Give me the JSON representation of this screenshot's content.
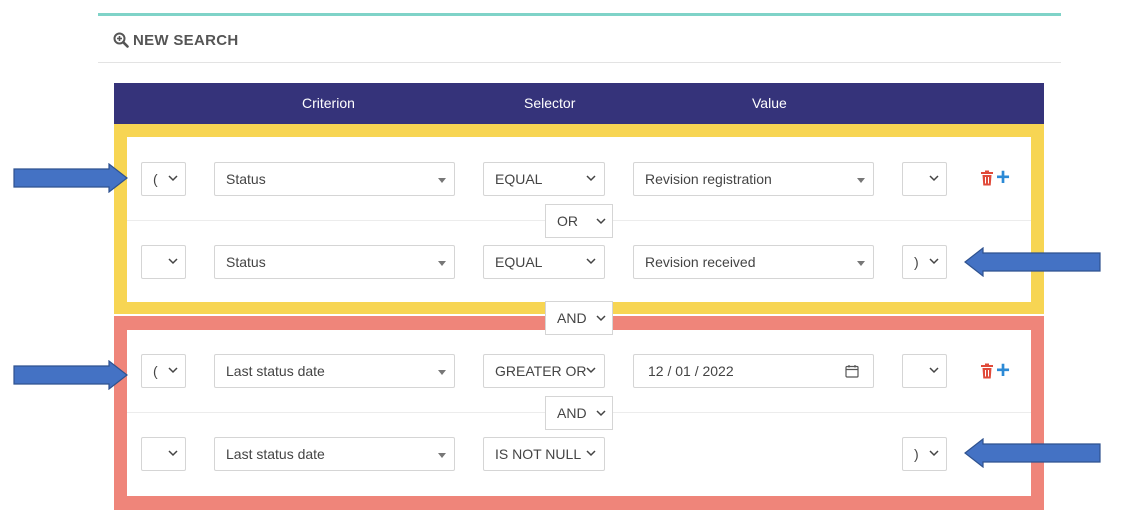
{
  "header": {
    "title": "NEW SEARCH",
    "icon": "zoom-in-icon"
  },
  "columns": {
    "criterion": "Criterion",
    "selector": "Selector",
    "value": "Value"
  },
  "logic_between_groups": "AND",
  "groups": [
    {
      "color": "#f7d553",
      "logic": "OR",
      "rows": [
        {
          "open_paren": "(",
          "criterion": "Status",
          "selector": "EQUAL",
          "value": "Revision registration",
          "close_paren": ""
        },
        {
          "open_paren": "",
          "criterion": "Status",
          "selector": "EQUAL",
          "value": "Revision received",
          "close_paren": ")"
        }
      ]
    },
    {
      "color": "#ef857a",
      "logic": "AND",
      "rows": [
        {
          "open_paren": "(",
          "criterion": "Last status date",
          "selector": "GREATER OR EQUAL",
          "value": "12 / 01 / 2022",
          "close_paren": ""
        },
        {
          "open_paren": "",
          "criterion": "Last status date",
          "selector": "IS NOT NULL",
          "value": "",
          "close_paren": ")"
        }
      ]
    }
  ],
  "colors": {
    "header_bg": "#35337a",
    "accent_rule": "#7fd3c8",
    "trash": "#e04a3a",
    "plus": "#2c8ad6",
    "arrow": "#4472c4"
  }
}
